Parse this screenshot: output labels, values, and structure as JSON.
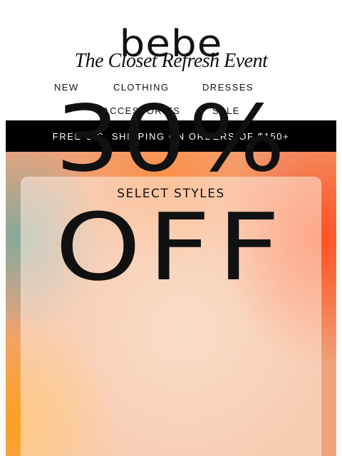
{
  "brand": {
    "logo_text": "bebe"
  },
  "nav": {
    "row1": [
      "NEW",
      "CLOTHING",
      "DRESSES"
    ],
    "row2": [
      "ACCESSORIES",
      "SALE"
    ]
  },
  "banner": {
    "text": "FREE U.S. SHIPPING ON ORDERS OF $150+"
  },
  "hero": {
    "event_title": "The Closet Refresh Event",
    "discount": "30%",
    "subtitle": "SELECT STYLES",
    "off": "OFF"
  },
  "colors": {
    "banner_bg": "#000000",
    "banner_text": "#ffffff",
    "hero_warm": "#f0a27a",
    "hero_orange": "#ff4614",
    "hero_teal": "#78aaa0"
  }
}
